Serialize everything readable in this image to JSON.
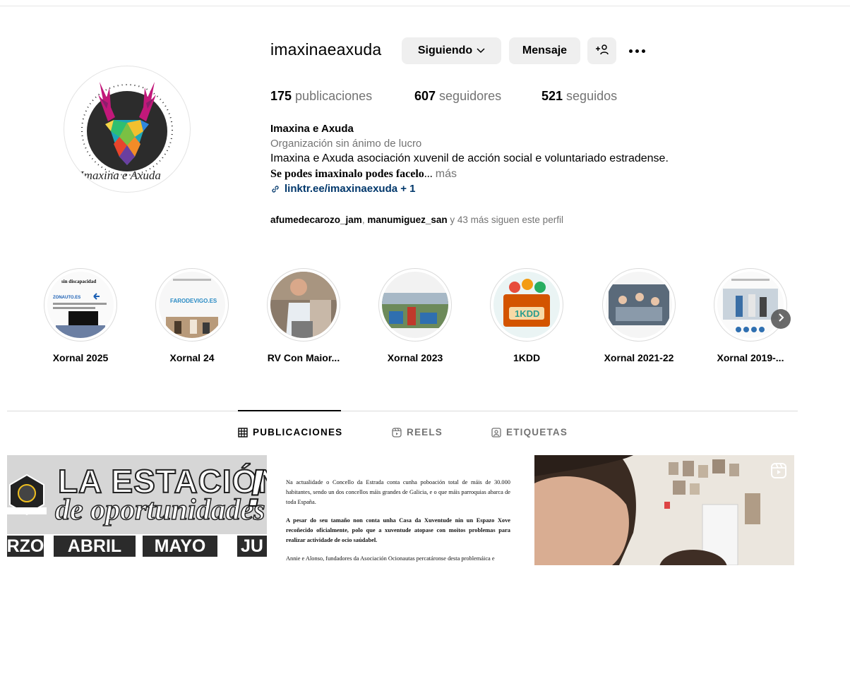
{
  "profile": {
    "username": "imaxinaeaxuda",
    "avatar_text": "Imaxina e Axuda",
    "buttons": {
      "following": "Siguiendo",
      "message": "Mensaje"
    },
    "stats": {
      "posts_count": "175",
      "posts_label": "publicaciones",
      "followers_count": "607",
      "followers_label": "seguidores",
      "following_count": "521",
      "following_label": "seguidos"
    },
    "bio": {
      "name": "Imaxina e Axuda",
      "category": "Organización sin ánimo de lucro",
      "text": "Imaxina e Axuda asociación xuvenil de acción social e voluntariado estradense.",
      "motto": "Se podes imaxinalo podes facelo",
      "ellipsis": "...",
      "more": "más",
      "link": "linktr.ee/imaxinaexuda + 1"
    },
    "followed_by": {
      "user1": "afumedecarozo_jam",
      "separator": ", ",
      "user2": "manumiguez_san",
      "rest": " y 43 más siguen este perfil"
    }
  },
  "highlights": [
    {
      "label": "Xornal 2025",
      "thumb_text": "sin discapacidad",
      "thumb_url": "ZONAUTO.ES"
    },
    {
      "label": "Xornal 24",
      "thumb_text": "FARODEVIGO.ES"
    },
    {
      "label": "RV Con Maior..."
    },
    {
      "label": "Xornal 2023"
    },
    {
      "label": "1KDD",
      "thumb_text": "1KDD"
    },
    {
      "label": "Xornal 2021-22"
    },
    {
      "label": "Xornal 2019-..."
    }
  ],
  "tabs": {
    "posts": "PUBLICACIONES",
    "reels": "REELS",
    "tagged": "ETIQUETAS"
  },
  "posts": {
    "post1": {
      "title": "LA ESTACIÓN",
      "subtitle": "de oportunidades",
      "exclamation": "!",
      "months": [
        "RZO",
        "ABRIL",
        "MAYO",
        "JU"
      ]
    },
    "post2": {
      "para1": "Na actualidade o Concello da Estrada conta cunha poboación total de máis de 30.000 habitantes, sendo un dos concellos máis grandes de Galicia, e o que máis parroquias abarca de toda España.",
      "para2": "A pesar do seu tamaño non conta unha Casa da Xuventude nin un Espazo Xove recoñecido oficialmente, polo que a xuventude atopase con moitos problemas para realizar actividade de ocio saúdabel.",
      "para3": "Annie e Alonso, fundadores da Asociación Ocionautas percatáronse desta problemáica e"
    }
  },
  "colors": {
    "button_bg": "#efefef",
    "muted_text": "#737373",
    "link": "#00376b",
    "divider": "#dbdbdb"
  }
}
